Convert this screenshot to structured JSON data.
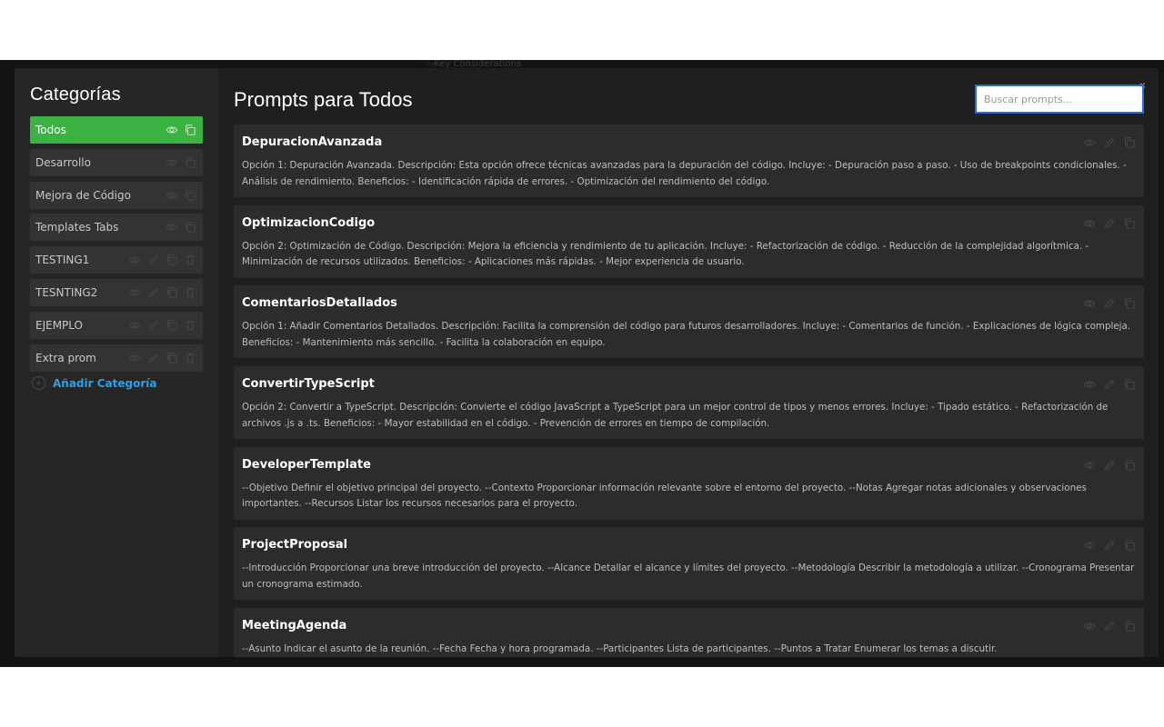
{
  "background": {
    "top_center": "--Key Considerations"
  },
  "sidebar": {
    "title": "Categorías",
    "items": [
      {
        "label": "Todos",
        "active": true,
        "icons": [
          "eye-icon",
          "copy-icon"
        ]
      },
      {
        "label": "Desarrollo",
        "active": false,
        "icons": [
          "eye-icon",
          "copy-icon"
        ]
      },
      {
        "label": "Mejora de Código",
        "active": false,
        "icons": [
          "eye-icon",
          "copy-icon"
        ]
      },
      {
        "label": "Templates Tabs",
        "active": false,
        "icons": [
          "eye-icon",
          "copy-icon"
        ]
      },
      {
        "label": "TESTING1",
        "active": false,
        "icons": [
          "eye-icon",
          "edit-icon",
          "copy-icon",
          "trash-icon"
        ]
      },
      {
        "label": "TESNTING2",
        "active": false,
        "icons": [
          "eye-icon",
          "edit-icon",
          "copy-icon",
          "trash-icon"
        ]
      },
      {
        "label": "EJEMPLO",
        "active": false,
        "icons": [
          "eye-icon",
          "edit-icon",
          "copy-icon",
          "trash-icon"
        ]
      },
      {
        "label": "Extra prom",
        "active": false,
        "icons": [
          "eye-icon",
          "edit-icon",
          "copy-icon",
          "trash-icon"
        ]
      }
    ],
    "add_label": "Añadir Categoría"
  },
  "main": {
    "title": "Prompts para Todos",
    "search_placeholder": "Buscar prompts...",
    "close_symbol": "×",
    "prompts": [
      {
        "title": "DepuracionAvanzada",
        "text": "Opción 1: Depuración Avanzada. Descripción: Esta opción ofrece técnicas avanzadas para la depuración del código. Incluye: - Depuración paso a paso. - Uso de breakpoints condicionales. - Análisis de rendimiento. Beneficios: - Identificación rápida de errores. - Optimización del rendimiento del código."
      },
      {
        "title": "OptimizacionCodigo",
        "text": "Opción 2: Optimización de Código. Descripción: Mejora la eficiencia y rendimiento de tu aplicación. Incluye: - Refactorización de código. - Reducción de la complejidad algorítmica. - Minimización de recursos utilizados. Beneficios: - Aplicaciones más rápidas. - Mejor experiencia de usuario."
      },
      {
        "title": "ComentariosDetallados",
        "text": "Opción 1: Añadir Comentarios Detallados. Descripción: Facilita la comprensión del código para futuros desarrolladores. Incluye: - Comentarios de función. - Explicaciones de lógica compleja. Beneficios: - Mantenimiento más sencillo. - Facilita la colaboración en equipo."
      },
      {
        "title": "ConvertirTypeScript",
        "text": "Opción 2: Convertir a TypeScript. Descripción: Convierte el código JavaScript a TypeScript para un mejor control de tipos y menos errores. Incluye: - Tipado estático. - Refactorización de archivos .js a .ts. Beneficios: - Mayor estabilidad en el código. - Prevención de errores en tiempo de compilación."
      },
      {
        "title": "DeveloperTemplate",
        "text": "--Objetivo Definir el objetivo principal del proyecto. --Contexto Proporcionar información relevante sobre el entorno del proyecto. --Notas Agregar notas adicionales y observaciones importantes. --Recursos Listar los recursos necesarios para el proyecto."
      },
      {
        "title": "ProjectProposal",
        "text": "--Introducción Proporcionar una breve introducción del proyecto. --Alcance Detallar el alcance y límites del proyecto. --Metodología Describir la metodología a utilizar. --Cronograma Presentar un cronograma estimado."
      },
      {
        "title": "MeetingAgenda",
        "text": "--Asunto Indicar el asunto de la reunión. --Fecha Fecha y hora programada. --Participantes Lista de participantes. --Puntos a Tratar Enumerar los temas a discutir."
      }
    ]
  },
  "colors": {
    "accent_green": "#3bb343",
    "link_blue": "#2f9ee8",
    "search_border": "#2d6cdf"
  }
}
